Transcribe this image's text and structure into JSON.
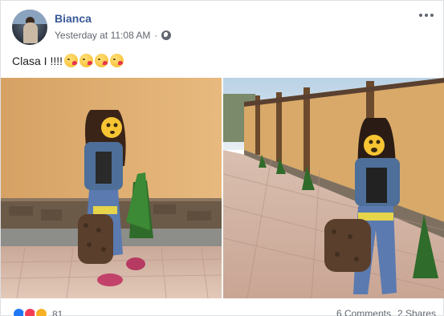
{
  "post": {
    "author": "Bianca",
    "timestamp": "Yesterday at 11:08 AM",
    "separator": "·",
    "privacy_icon": "globe-icon",
    "text": "Clasa I !!!!",
    "emoji_icon": "kissing-heart-emoji",
    "emoji_count": 4
  },
  "footer": {
    "reaction_icons": [
      "like-icon",
      "love-icon",
      "wow-icon"
    ],
    "reaction_count": "81",
    "comments": "6 Comments",
    "shares": "2 Shares"
  },
  "colors": {
    "author_link": "#385898",
    "meta_text": "#616770",
    "like": "#2078f4",
    "love": "#f33e58",
    "wow": "#f7b125"
  }
}
